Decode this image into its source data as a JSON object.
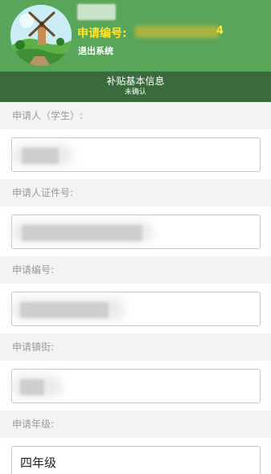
{
  "header": {
    "user_name": "",
    "app_no_label": "申请编号:",
    "app_no_value": "",
    "app_no_tail": "4",
    "logout_label": "退出系统"
  },
  "section": {
    "title": "补贴基本信息",
    "status": "未确认"
  },
  "form": {
    "fields": [
      {
        "label": "申请人（学生）:",
        "value": ""
      },
      {
        "label": "申请人证件号:",
        "value": ""
      },
      {
        "label": "申请编号:",
        "value": ""
      },
      {
        "label": "申请镇街:",
        "value": ""
      },
      {
        "label": "申请年级:",
        "value": "四年级"
      }
    ]
  },
  "colors": {
    "header_green": "#59a55a",
    "section_green": "#3b6b3d",
    "highlight_yellow": "#ffe62a",
    "label_bg": "#f3f3f3"
  }
}
